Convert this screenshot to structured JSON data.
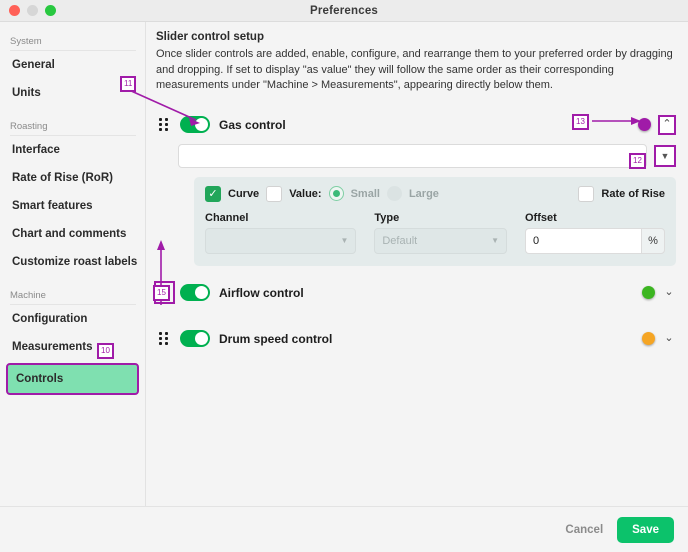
{
  "window": {
    "title": "Preferences"
  },
  "traffic_lights": [
    {
      "name": "close",
      "color": "#ff6057"
    },
    {
      "name": "minimize",
      "color": "#d6d6d6"
    },
    {
      "name": "zoom",
      "color": "#28c840"
    }
  ],
  "sidebar": {
    "groups": [
      {
        "label": "System",
        "items": [
          {
            "label": "General"
          },
          {
            "label": "Units"
          }
        ]
      },
      {
        "label": "Roasting",
        "items": [
          {
            "label": "Interface"
          },
          {
            "label": "Rate of Rise (RoR)"
          },
          {
            "label": "Smart features"
          },
          {
            "label": "Chart and comments"
          },
          {
            "label": "Customize roast labels"
          }
        ]
      },
      {
        "label": "Machine",
        "items": [
          {
            "label": "Configuration"
          },
          {
            "label": "Measurements"
          },
          {
            "label": "Controls"
          }
        ]
      }
    ]
  },
  "main": {
    "title": "Slider control setup",
    "description": "Once slider controls are added, enable, configure, and rearrange them to your preferred order by dragging and dropping. If set to display \"as value\" they will follow the same order as their corresponding measurements under \"Machine > Measurements\", appearing directly below them."
  },
  "controls": [
    {
      "label": "Gas control",
      "enabled": true,
      "dot_color": "#a01ba8",
      "chevron": "⌃",
      "expanded": true
    },
    {
      "label": "Airflow control",
      "enabled": true,
      "dot_color": "#3cb521",
      "chevron": "⌄",
      "expanded": false
    },
    {
      "label": "Drum speed control",
      "enabled": true,
      "dot_color": "#f5a524",
      "chevron": "⌄",
      "expanded": false
    }
  ],
  "combo": {
    "value": "",
    "button_icon": "▼"
  },
  "config": {
    "curve_label": "Curve",
    "curve_checked": true,
    "curve_check_glyph": "✓",
    "value_label": "Value:",
    "value_checked": false,
    "size_options": [
      {
        "label": "Small",
        "selected": true
      },
      {
        "label": "Large",
        "selected": false
      }
    ],
    "rate_of_rise_label": "Rate of Rise",
    "rate_of_rise_checked": false,
    "channel_label": "Channel",
    "channel_value": "",
    "type_label": "Type",
    "type_value": "Default",
    "offset_label": "Offset",
    "offset_value": "0",
    "offset_unit": "%",
    "select_arrow": "▼"
  },
  "footer": {
    "cancel_label": "Cancel",
    "save_label": "Save"
  },
  "annotations": [
    {
      "id": "10",
      "text": "10"
    },
    {
      "id": "11",
      "text": "11"
    },
    {
      "id": "12",
      "text": "12"
    },
    {
      "id": "13",
      "text": "13"
    },
    {
      "id": "15",
      "text": "15"
    }
  ],
  "colors": {
    "accent_purple": "#a01ba8",
    "toggle_green": "#00b050",
    "save_green": "#0cc26b",
    "selected_nav": "#7fe0b0"
  }
}
